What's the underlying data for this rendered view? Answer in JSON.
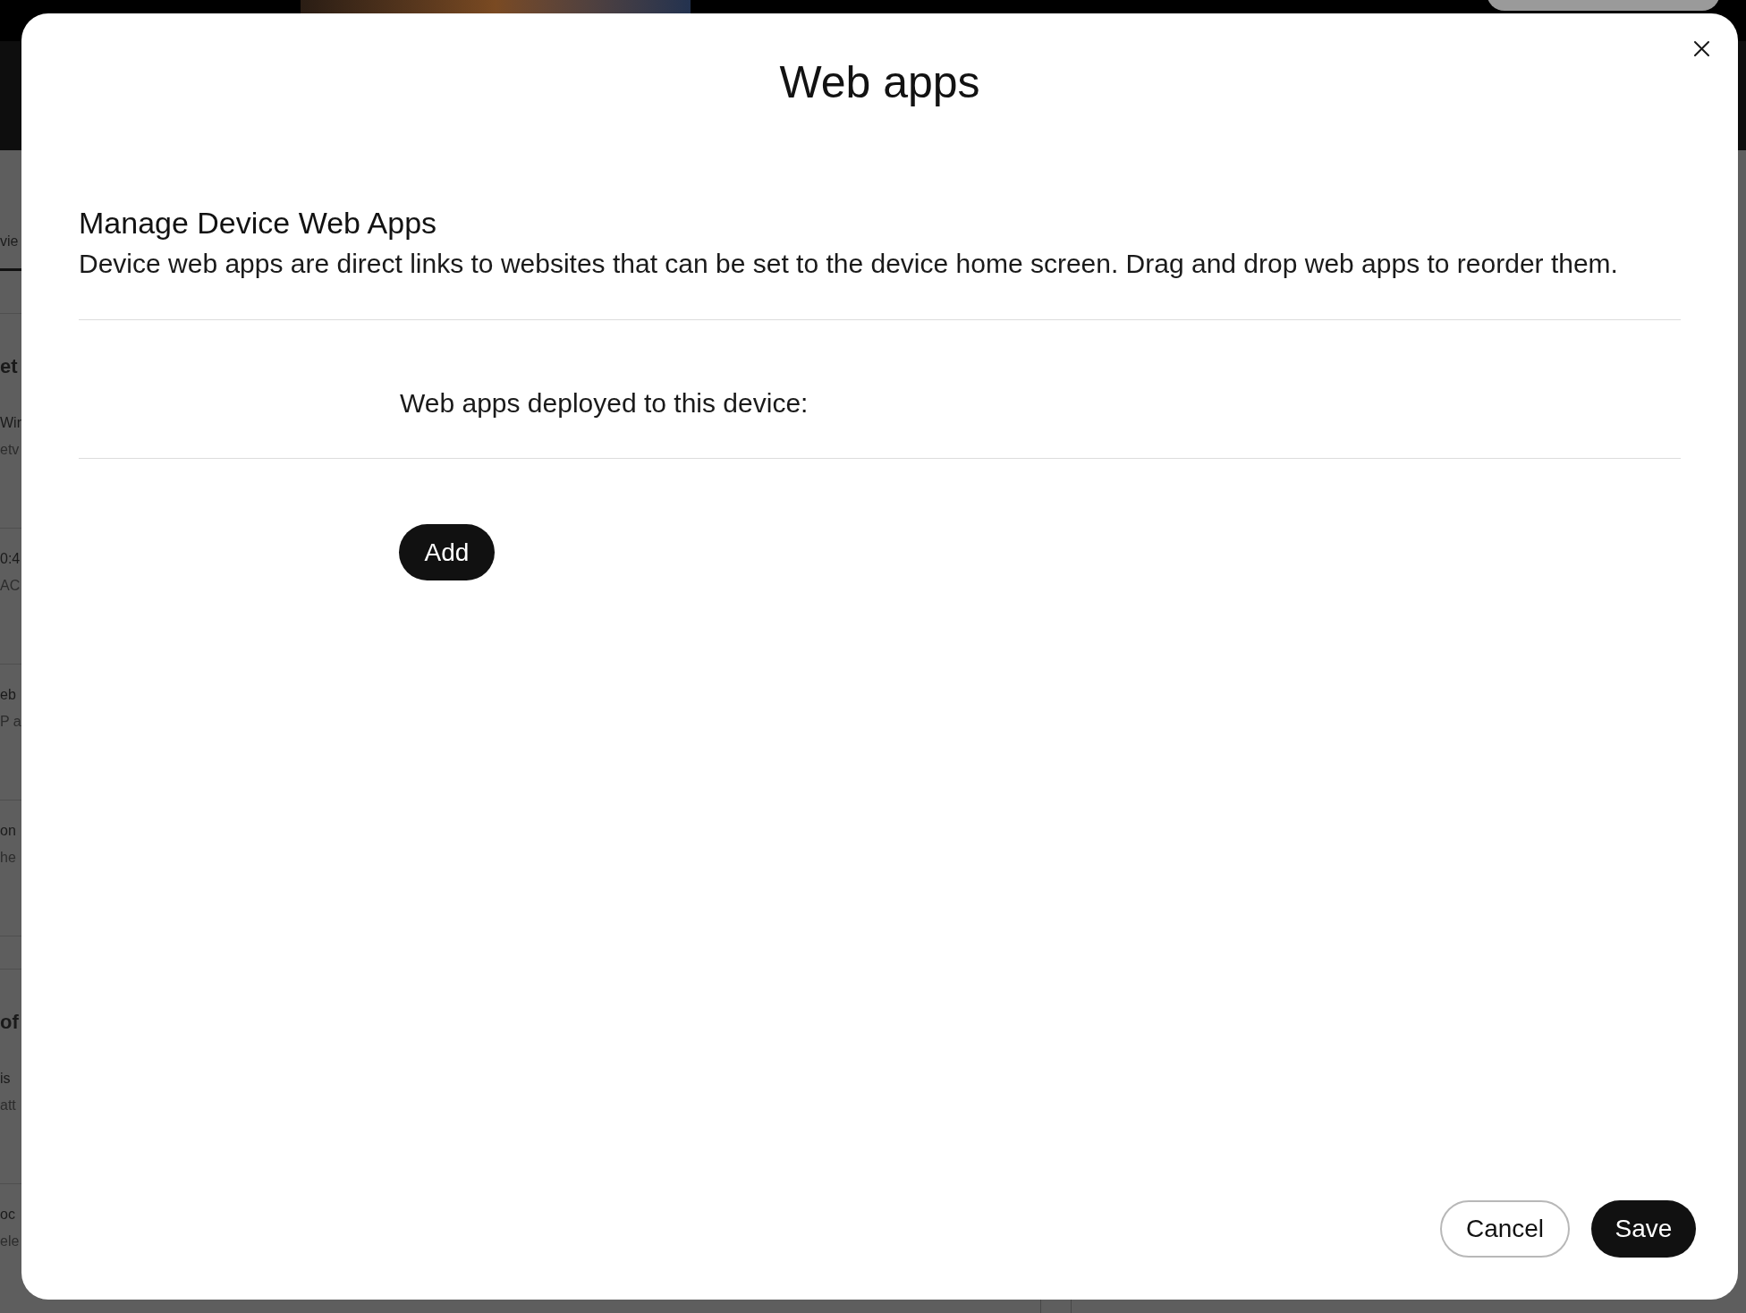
{
  "backdrop": {
    "tab": {
      "label": "vie",
      "selected": true
    },
    "sections": [
      {
        "heading": "et",
        "rows": [
          {
            "title": "Wir",
            "subtitle": "etv"
          },
          {
            "title": "0:4",
            "subtitle": "AC"
          },
          {
            "title": "eb",
            "subtitle": "P a"
          },
          {
            "title": "on",
            "subtitle": "he"
          }
        ]
      },
      {
        "heading": "of",
        "rows": [
          {
            "title": "is",
            "subtitle": "att"
          },
          {
            "title": "oc",
            "subtitle": "ele"
          }
        ]
      }
    ]
  },
  "dialog": {
    "title": "Web apps",
    "heading": "Manage Device Web Apps",
    "description": "Device web apps are direct links to websites that can be set to the device home screen. Drag and drop web apps to reorder them.",
    "deployed_label": "Web apps deployed to this device:",
    "add_button": "Add",
    "footer_buttons": [
      {
        "label": "Cancel",
        "kind": "secondary"
      },
      {
        "label": "Save",
        "kind": "primary"
      }
    ]
  }
}
